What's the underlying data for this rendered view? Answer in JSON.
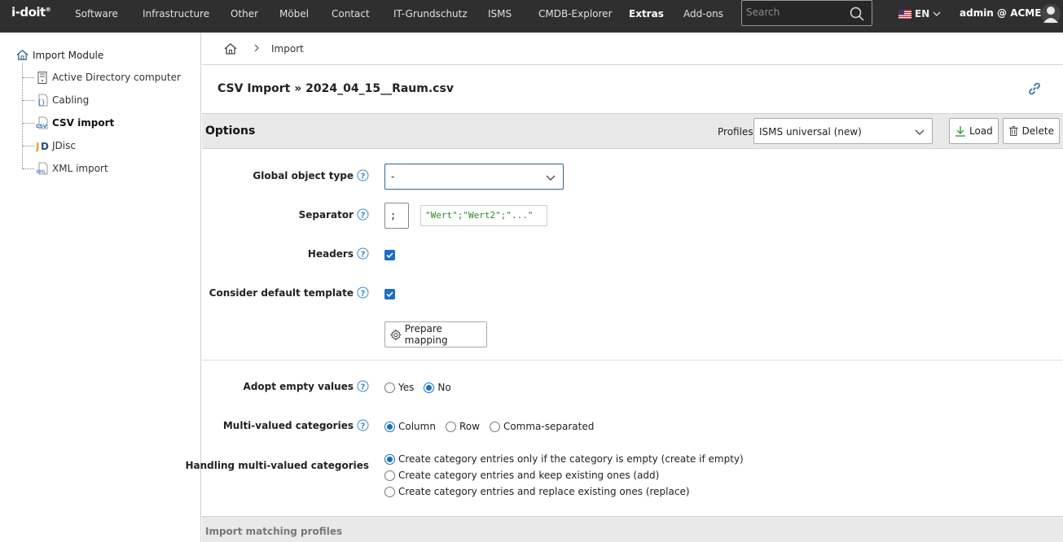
{
  "topbar": {
    "logo": "i-doit",
    "nav": [
      "Software",
      "Infrastructure",
      "Other",
      "Möbel",
      "Contact",
      "IT-Grundschutz",
      "ISMS",
      "CMDB-Explorer",
      "Extras",
      "Add-ons"
    ],
    "active_nav": "Extras",
    "search_placeholder": "Search",
    "language": "EN",
    "user": "admin @ ACME"
  },
  "sidebar": {
    "root": "Import Module",
    "items": [
      {
        "label": "Active Directory computer",
        "icon": "server-icon"
      },
      {
        "label": "Cabling",
        "icon": "braces-file-icon"
      },
      {
        "label": "CSV import",
        "icon": "csv-file-icon",
        "active": true
      },
      {
        "label": "JDisc",
        "icon": "jdisc-icon"
      },
      {
        "label": "XML import",
        "icon": "xml-file-icon"
      }
    ]
  },
  "breadcrumb": {
    "item": "Import"
  },
  "page_title": "CSV Import » 2024_04_15__Raum.csv",
  "options": {
    "title": "Options",
    "profiles_label": "Profiles",
    "profile_selected": "ISMS universal (new)",
    "load_label": "Load",
    "delete_label": "Delete"
  },
  "form": {
    "global_object_type": {
      "label": "Global object type",
      "value": "-"
    },
    "separator": {
      "label": "Separator",
      "value": ";",
      "example": "\"Wert\";\"Wert2\";\"...\""
    },
    "headers": {
      "label": "Headers",
      "checked": true
    },
    "default_template": {
      "label": "Consider default template",
      "checked": true
    },
    "prepare_mapping": "Prepare mapping",
    "adopt_empty": {
      "label": "Adopt empty values",
      "options": [
        "Yes",
        "No"
      ],
      "selected": "No"
    },
    "multi_valued": {
      "label": "Multi-valued categories",
      "options": [
        "Column",
        "Row",
        "Comma-separated"
      ],
      "selected": "Column"
    },
    "handling": {
      "label": "Handling multi-valued categories",
      "options": [
        "Create category entries only if the category is empty (create if empty)",
        "Create category entries and keep existing ones (add)",
        "Create category entries and replace existing ones (replace)"
      ],
      "selected": 0
    }
  },
  "footer_section": "Import matching profiles",
  "colors": {
    "accent": "#1a6fc4",
    "topbar": "#2f2f2f",
    "panel": "#e9e9e9"
  }
}
